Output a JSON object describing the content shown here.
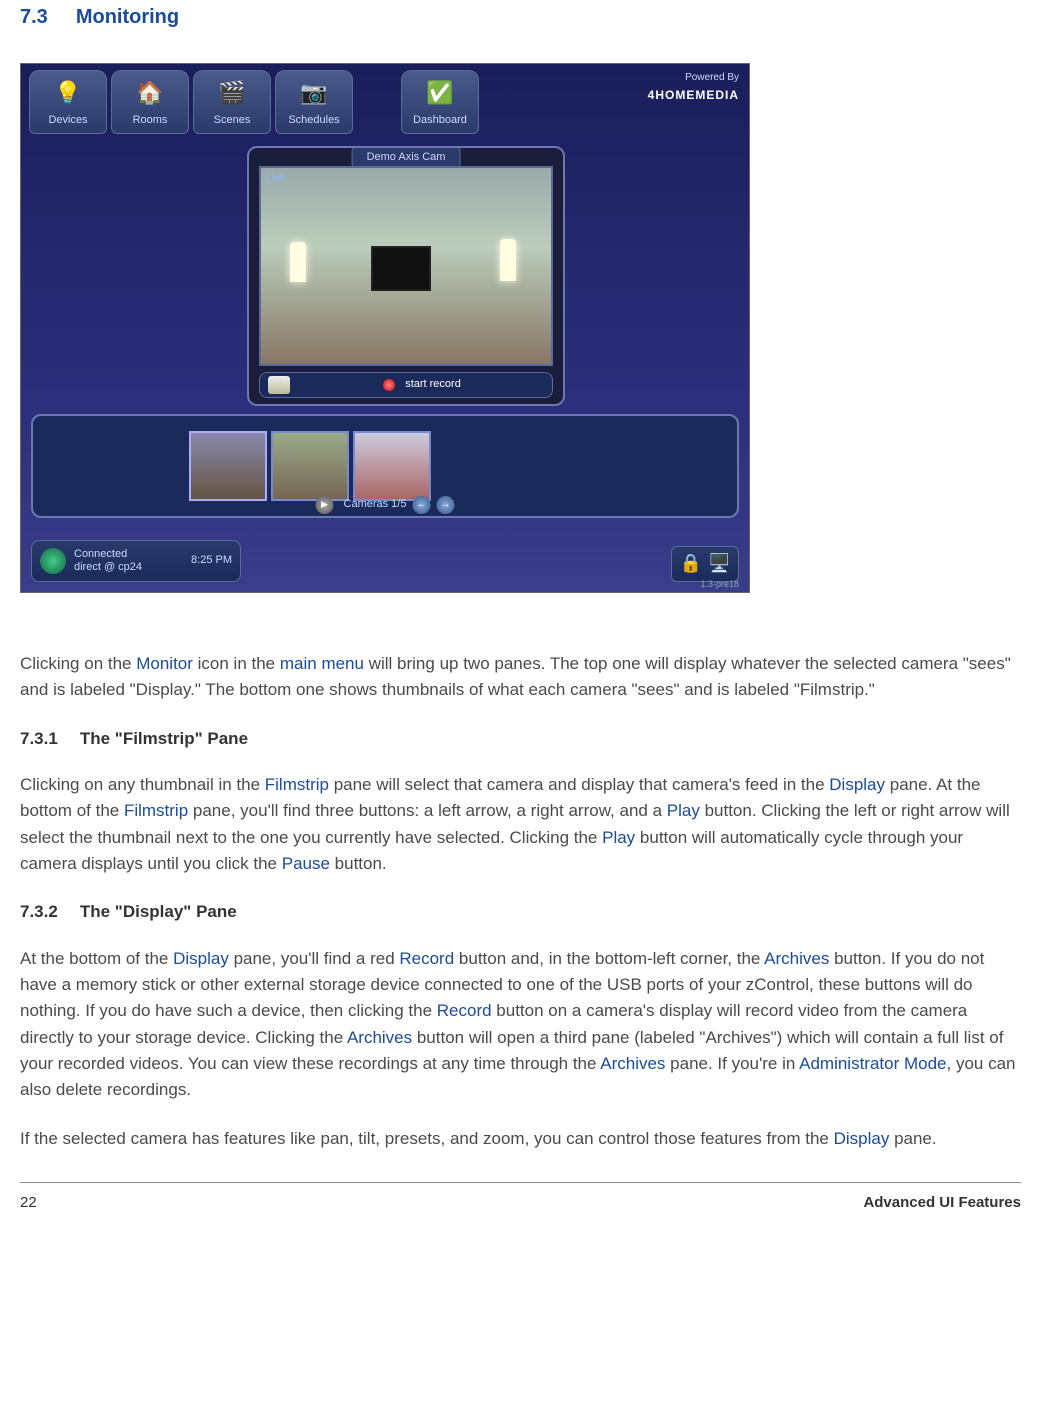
{
  "heading": {
    "num": "7.3",
    "title": "Monitoring"
  },
  "screenshot": {
    "nav": [
      "Devices",
      "Rooms",
      "Scenes",
      "Schedules",
      "Dashboard"
    ],
    "logo_top": "Powered By",
    "logo_brand_prefix": "4",
    "logo_brand": "HOMEMEDIA",
    "display_title": "Demo Axis Cam",
    "live": "Live",
    "start_record": "start record",
    "cameras_label": "Cameras 1/5",
    "status_line1": "Connected",
    "status_line2": "direct @ cp24",
    "status_time": "8:25 PM",
    "version": "1.3-pre18"
  },
  "p1": {
    "a": "Clicking on the ",
    "monitor": "Monitor",
    "b": " icon in the ",
    "mainmenu": "main menu",
    "c": " will bring up two panes. The top one will display whatever the selected camera \"sees\" and is labeled \"Display.\" The bottom one shows thumbnails of what each camera \"sees\" and is labeled \"Filmstrip.\""
  },
  "sub1": {
    "num": "7.3.1",
    "title": "The \"Filmstrip\" Pane"
  },
  "p2": {
    "a": "Clicking on any thumbnail in the ",
    "filmstrip1": "Filmstrip",
    "b": " pane will select that camera and display that camera's feed in the ",
    "display1": "Display",
    "c": " pane. At the bottom of the ",
    "filmstrip2": "Filmstrip",
    "d": " pane, you'll find three buttons: a left arrow, a right arrow, and a ",
    "play": "Play",
    "e": " button. Clicking the left or right arrow will select the thumbnail next to the one you currently have selected. Clicking the ",
    "play2": "Play",
    "f": " button will automatically cycle through your camera displays until you click the ",
    "pause": "Pause",
    "g": " button."
  },
  "sub2": {
    "num": "7.3.2",
    "title": "The \"Display\" Pane"
  },
  "p3": {
    "a": "At the bottom of the ",
    "display": "Display",
    "b": " pane, you'll find a red ",
    "record1": "Record",
    "c": " button and, in the bottom-left corner, the ",
    "archives1": "Archives",
    "d": " button. If you do not have a memory stick or other external storage device connected to one of the USB ports of your zControl, these buttons will do nothing. If you do have such a device, then clicking the ",
    "record2": "Record",
    "e": " button on a camera's display will record video from the camera directly to your storage device. Clicking the ",
    "archives2": "Archives",
    "f": " button will open a third pane (labeled \"Archives\") which will contain a full list of your recorded videos. You can view these recordings at any time through the ",
    "archives3": "Archives",
    "g": " pane. If you're in ",
    "admin": "Administrator Mode",
    "h": ", you can also delete recordings."
  },
  "p4": {
    "a": "If the selected camera has features like pan, tilt, presets, and zoom, you can control those features from the ",
    "display": "Display",
    "b": " pane."
  },
  "footer": {
    "page": "22",
    "chapter": "Advanced UI Features"
  }
}
